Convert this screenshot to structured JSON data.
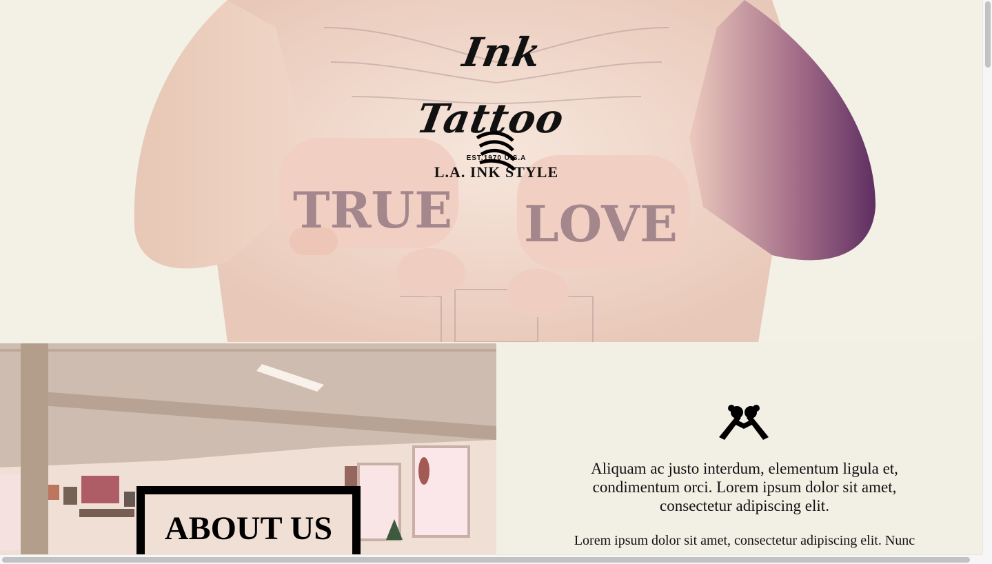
{
  "hero": {
    "logo": {
      "script_text": "Ink Tattoo",
      "established": "EST.1970 U.S.A",
      "tagline": "L.A. INK STYLE"
    },
    "knuckles_left": "TRUE",
    "knuckles_right": "LOVE",
    "menu_icon": "menu-icon"
  },
  "about": {
    "title": "ABOUT US",
    "icon": "tattoo-machines-icon",
    "lead": "Aliquam ac justo interdum, elementum ligula et, condimentum orci. Lorem ipsum dolor sit amet, consectetur adipiscing elit.",
    "body": "Lorem ipsum dolor sit amet, consectetur adipiscing elit. Nunc"
  },
  "colors": {
    "page_bg": "#f2efe5",
    "text": "#111111",
    "frame": "#000000",
    "skin": "#e8c3b4",
    "tattoo_purple": "#6e3a6a"
  }
}
